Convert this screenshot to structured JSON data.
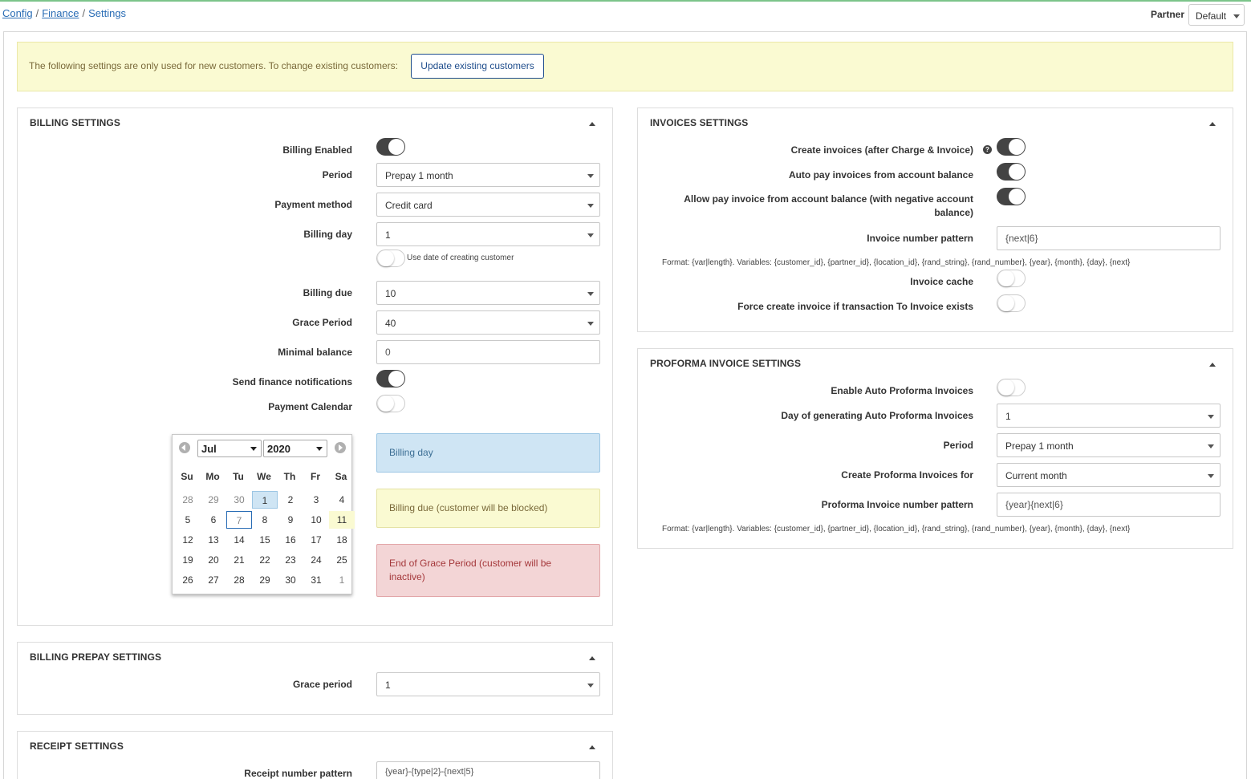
{
  "breadcrumb": {
    "config": "Config",
    "finance": "Finance",
    "current": "Settings",
    "sep": "/"
  },
  "partner": {
    "label": "Partner",
    "value": "Default"
  },
  "alert": {
    "text": "The following settings are only used for new customers. To change existing customers:",
    "button": "Update existing customers"
  },
  "billing": {
    "title": "BILLING SETTINGS",
    "enabled_label": "Billing Enabled",
    "period_label": "Period",
    "period_value": "Prepay 1 month",
    "payment_method_label": "Payment method",
    "payment_method_value": "Credit card",
    "billing_day_label": "Billing day",
    "billing_day_value": "1",
    "use_date_label": "Use date of creating customer",
    "billing_due_label": "Billing due",
    "billing_due_value": "10",
    "grace_label": "Grace Period",
    "grace_value": "40",
    "min_balance_label": "Minimal balance",
    "min_balance_value": "0",
    "send_notif_label": "Send finance notifications",
    "calendar_label": "Payment Calendar",
    "legend": {
      "billing_day": "Billing day",
      "billing_due": "Billing due (customer will be blocked)",
      "grace_end": "End of Grace Period (customer will be inactive)"
    }
  },
  "calendar": {
    "month": "Jul",
    "year": "2020",
    "dow": [
      "Su",
      "Mo",
      "Tu",
      "We",
      "Th",
      "Fr",
      "Sa"
    ],
    "weeks": [
      [
        "28",
        "29",
        "30",
        "1",
        "2",
        "3",
        "4"
      ],
      [
        "5",
        "6",
        "7",
        "8",
        "9",
        "10",
        "11"
      ],
      [
        "12",
        "13",
        "14",
        "15",
        "16",
        "17",
        "18"
      ],
      [
        "19",
        "20",
        "21",
        "22",
        "23",
        "24",
        "25"
      ],
      [
        "26",
        "27",
        "28",
        "29",
        "30",
        "31",
        "1"
      ]
    ]
  },
  "prepay": {
    "title": "BILLING PREPAY SETTINGS",
    "grace_label": "Grace period",
    "grace_value": "1"
  },
  "receipt": {
    "title": "RECEIPT SETTINGS",
    "pattern_label": "Receipt number pattern",
    "pattern_value": "{year}-{type|2}-{next|5}"
  },
  "invoices": {
    "title": "INVOICES SETTINGS",
    "create_label": "Create invoices (after Charge & Invoice)",
    "help": "?",
    "auto_pay_label": "Auto pay invoices from account balance",
    "allow_pay_label": "Allow pay invoice from account balance (with negative account balance)",
    "pattern_label": "Invoice number pattern",
    "pattern_value": "{next|6}",
    "format": "Format: {var|length}. Variables: {customer_id}, {partner_id}, {location_id}, {rand_string}, {rand_number}, {year}, {month}, {day}, {next}",
    "cache_label": "Invoice cache",
    "force_label": "Force create invoice if transaction To Invoice exists"
  },
  "proforma": {
    "title": "PROFORMA INVOICE SETTINGS",
    "enable_label": "Enable Auto Proforma Invoices",
    "day_label": "Day of generating Auto Proforma Invoices",
    "day_value": "1",
    "period_label": "Period",
    "period_value": "Prepay 1 month",
    "create_for_label": "Create Proforma Invoices for",
    "create_for_value": "Current month",
    "pattern_label": "Proforma Invoice number pattern",
    "pattern_value": "{year}{next|6}",
    "format": "Format: {var|length}. Variables: {customer_id}, {partner_id}, {location_id}, {rand_string}, {rand_number}, {year}, {month}, {day}, {next}"
  }
}
